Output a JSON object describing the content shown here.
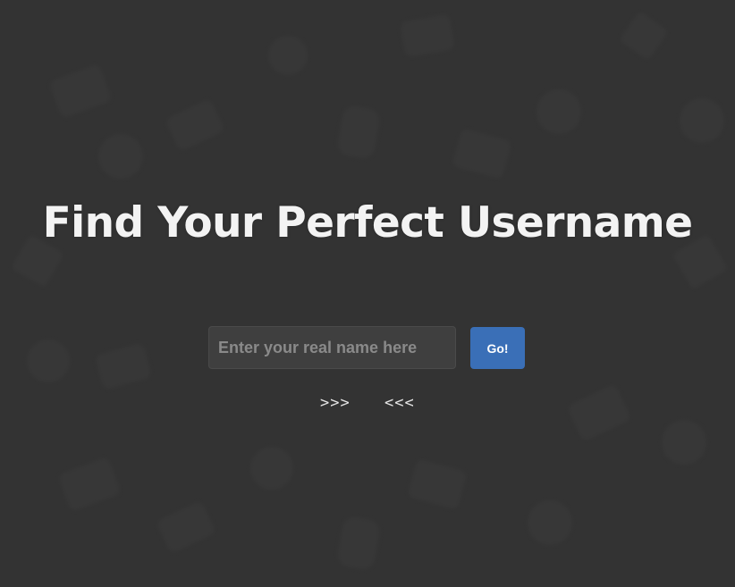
{
  "title": "Find Your Perfect Username",
  "name_input": {
    "value": "",
    "placeholder": "Enter your real name here"
  },
  "go_button": {
    "label": "Go!"
  },
  "arrows": {
    "left": ">>>",
    "right": "<<<"
  },
  "colors": {
    "background": "#333333",
    "accent": "#3a6fb7",
    "title": "#f3f3f3"
  }
}
